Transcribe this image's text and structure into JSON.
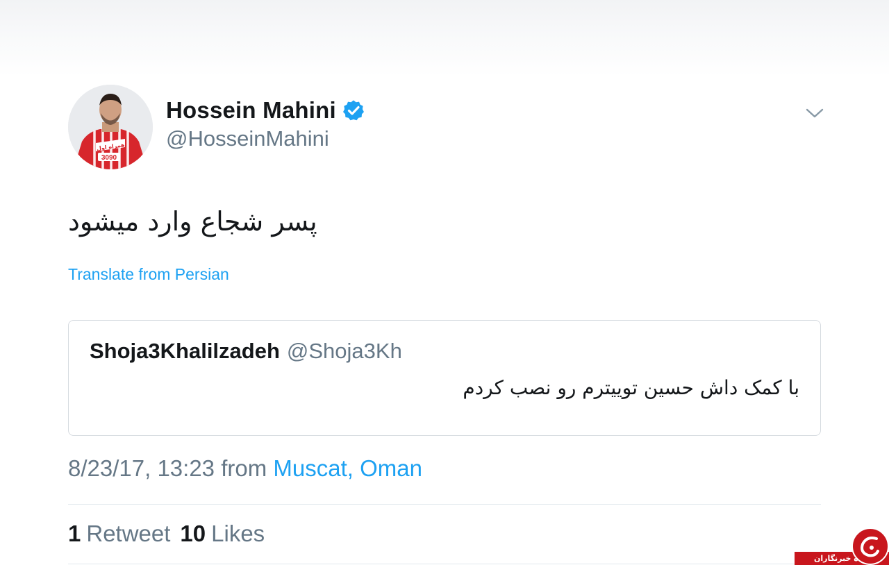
{
  "tweet": {
    "author": {
      "name": "Hossein Mahini",
      "handle": "@HosseinMahini",
      "verified": true,
      "avatar": {
        "description": "player in red striped jersey",
        "jersey_number": "3090",
        "jersey_sponsor": "همراه اول"
      }
    },
    "text": "پسر شجاع وارد میشود",
    "translate_label": "Translate from Persian",
    "quoted": {
      "name": "Shoja3Khalilzadeh",
      "handle": "@Shoja3Kh",
      "text": "با کمک داش حسین توییترم رو نصب کردم"
    },
    "meta": {
      "timestamp": "8/23/17, 13:23",
      "from_label": "from",
      "location": "Muscat, Oman"
    },
    "stats": {
      "retweets_count": "1",
      "retweets_label": "Retweet",
      "likes_count": "10",
      "likes_label": "Likes"
    }
  },
  "watermark": {
    "text": "باشگاه خبرنگاران"
  },
  "colors": {
    "accent": "#1da1f2",
    "text_primary": "#14171a",
    "text_secondary": "#657786",
    "border": "#d6dbe0",
    "watermark_red": "#c8161d"
  },
  "icons": {
    "verified": "verified-badge-icon",
    "caret": "chevron-down-icon",
    "watermark": "watermark-logo-icon"
  }
}
